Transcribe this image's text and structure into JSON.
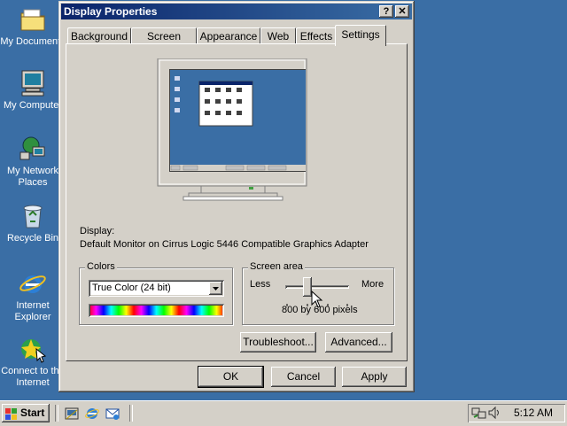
{
  "desktop": {
    "icons": [
      {
        "label": "My Documents",
        "icon": "folder-icon"
      },
      {
        "label": "My Computer",
        "icon": "computer-icon"
      },
      {
        "label": "My Network Places",
        "icon": "network-icon"
      },
      {
        "label": "Recycle Bin",
        "icon": "recycle-bin-icon"
      },
      {
        "label": "Internet Explorer",
        "icon": "ie-icon"
      },
      {
        "label": "Connect to the Internet",
        "icon": "connect-icon"
      }
    ]
  },
  "window": {
    "title": "Display Properties",
    "help_btn": "?",
    "close_btn": "✕",
    "tabs": [
      "Background",
      "Screen Saver",
      "Appearance",
      "Web",
      "Effects",
      "Settings"
    ],
    "active_tab": "Settings",
    "display_label": "Display:",
    "display_value": "Default Monitor on Cirrus Logic 5446 Compatible Graphics Adapter",
    "colors": {
      "legend": "Colors",
      "selected": "True Color (24 bit)"
    },
    "screen_area": {
      "legend": "Screen area",
      "less": "Less",
      "more": "More",
      "value": "800 by 600 pixels",
      "slider_fraction": 0.33
    },
    "troubleshoot_btn": "Troubleshoot...",
    "advanced_btn": "Advanced...",
    "ok_btn": "OK",
    "cancel_btn": "Cancel",
    "apply_btn": "Apply"
  },
  "taskbar": {
    "start_label": "Start",
    "clock": "5:12 AM"
  },
  "colors": {
    "desktop": "#3a6ea5",
    "titlebar_start": "#0a246a",
    "face": "#d4d0c8"
  }
}
